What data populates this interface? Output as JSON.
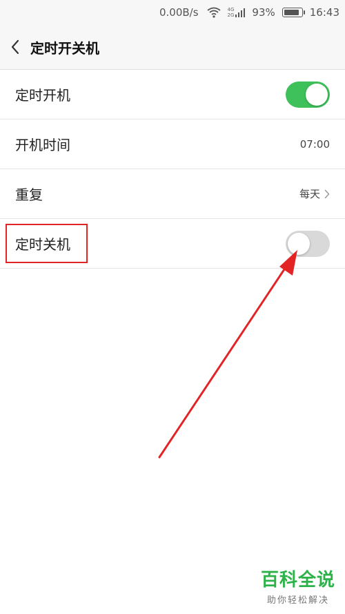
{
  "status_bar": {
    "net_speed": "0.00B/s",
    "net_types": [
      "4G",
      "2G"
    ],
    "battery_percent": "93%",
    "battery_level": 0.93,
    "time": "16:43"
  },
  "header": {
    "title": "定时开关机"
  },
  "settings": {
    "power_on": {
      "label": "定时开机",
      "enabled": true
    },
    "power_on_time": {
      "label": "开机时间",
      "value": "07:00"
    },
    "repeat": {
      "label": "重复",
      "value": "每天"
    },
    "power_off": {
      "label": "定时关机",
      "enabled": false
    }
  },
  "colors": {
    "toggle_on": "#3ec05a",
    "toggle_off": "#d9d9d9",
    "annotation": "#e32424",
    "brand": "#2db24a"
  },
  "watermark": {
    "brand": "百科全说",
    "slogan": "助你轻松解决"
  }
}
